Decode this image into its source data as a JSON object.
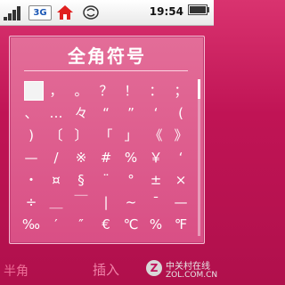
{
  "status_bar": {
    "network_label": "3G",
    "time": "19:54"
  },
  "dialog": {
    "title": "全角符号",
    "rows": [
      [
        "",
        "，",
        "。",
        "？",
        "！",
        "：",
        "；"
      ],
      [
        "、",
        "…",
        "々",
        "“",
        "”",
        "‘",
        "("
      ],
      [
        ")",
        "〔",
        "〕",
        "「",
        "」",
        "《",
        "》"
      ],
      [
        "—",
        "/",
        "※",
        "#",
        "%",
        "￥",
        "‘"
      ],
      [
        "・",
        "¤",
        "§",
        "¨",
        "°",
        "±",
        "×"
      ],
      [
        "÷",
        "＿",
        "￣",
        "|",
        "~",
        "¯",
        "—"
      ],
      [
        "‰",
        "′",
        "″",
        "€",
        "℃",
        "%",
        "℉"
      ]
    ]
  },
  "softkeys": {
    "left": "半角",
    "center": "插入"
  },
  "watermark": {
    "cn": "中关村在线",
    "en": "ZOL.COM.CN",
    "logo_letter": "Z"
  }
}
